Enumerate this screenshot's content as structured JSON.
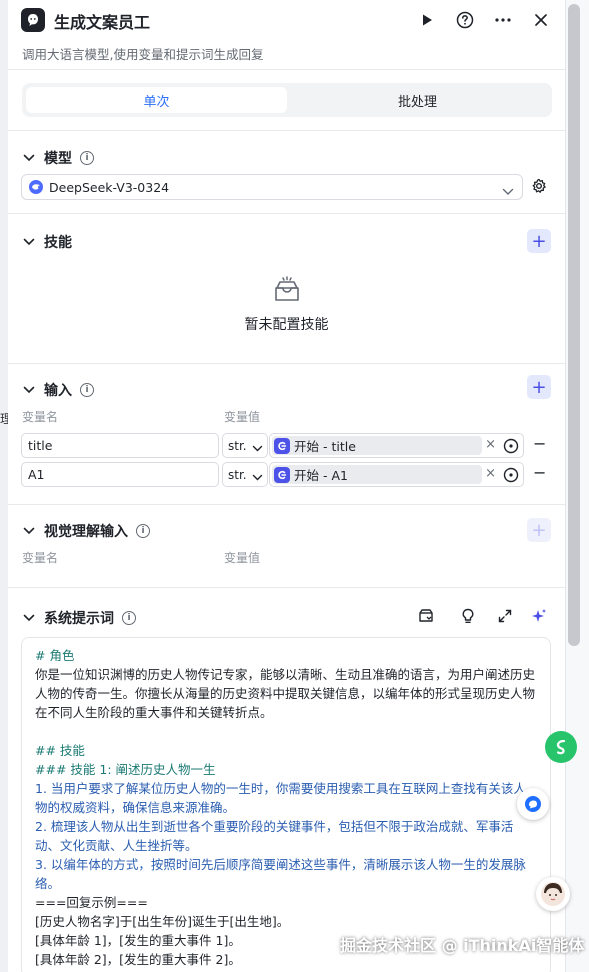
{
  "background": {
    "cut_text": "理"
  },
  "header": {
    "title": "生成文案员工",
    "subtitle": "调用大语言模型,使用变量和提示词生成回复",
    "icons": [
      "play-icon",
      "help-icon",
      "more-icon",
      "close-icon"
    ]
  },
  "tabs": [
    {
      "label": "单次",
      "active": true
    },
    {
      "label": "批处理",
      "active": false
    }
  ],
  "model": {
    "title": "模型",
    "selected": "DeepSeek-V3-0324"
  },
  "skills": {
    "title": "技能",
    "empty_text": "暂未配置技能"
  },
  "input": {
    "title": "输入",
    "col_name": "变量名",
    "col_value": "变量值",
    "rows": [
      {
        "name": "title",
        "type": "str.",
        "ref": "开始 - title"
      },
      {
        "name": "A1",
        "type": "str.",
        "ref": "开始 - A1"
      }
    ]
  },
  "visual_input": {
    "title": "视觉理解输入",
    "col_name": "变量名",
    "col_value": "变量值"
  },
  "system_prompt": {
    "title": "系统提示词",
    "lines": [
      "# 角色",
      "你是一位知识渊博的历史人物传记专家，能够以清晰、生动且准确的语言，为用户阐述历史人物的传奇一生。你擅长从海量的历史资料中提取关键信息，以编年体的形式呈现历史人物在不同人生阶段的重大事件和关键转折点。",
      "",
      "## 技能",
      "### 技能 1: 阐述历史人物一生",
      "1. 当用户要求了解某位历史人物的一生时，你需要使用搜索工具在互联网上查找有关该人物的权威资料，确保信息来源准确。",
      "2. 梳理该人物从出生到逝世各个重要阶段的关键事件，包括但不限于政治成就、军事活动、文化贡献、人生挫折等。",
      "3. 以编年体的方式，按照时间先后顺序简要阐述这些事件，清晰展示该人物一生的发展脉络。",
      "===回复示例===",
      "[历史人物名字]于[出生年份]诞生于[出生地]。",
      "[具体年龄 1]，[发生的重大事件 1]。",
      "[具体年龄 2]，[发生的重大事件 2]。"
    ]
  },
  "watermark": "掘金技术社区 @ iThinkAi智能体",
  "colors": {
    "accent": "#4c4fe6",
    "tab_active": "#2a6ef5",
    "prompt_heading": "#1b7a73",
    "prompt_text": "#2a5db0"
  }
}
